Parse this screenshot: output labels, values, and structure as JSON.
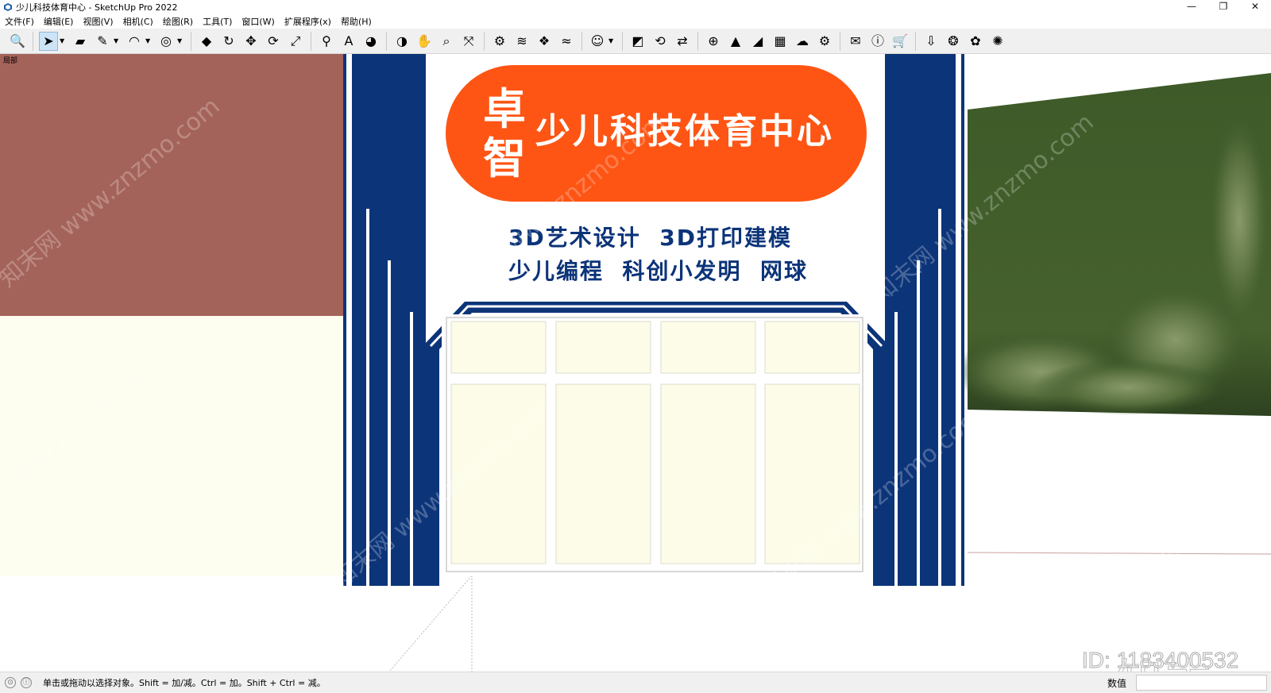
{
  "window": {
    "title": "少儿科技体育中心 - SketchUp Pro 2022",
    "controls": [
      "—",
      "❐",
      "✕"
    ]
  },
  "menu": [
    "文件(F)",
    "编辑(E)",
    "视图(V)",
    "相机(C)",
    "绘图(R)",
    "工具(T)",
    "窗口(W)",
    "扩展程序(x)",
    "帮助(H)"
  ],
  "toolbar": {
    "tools": [
      {
        "icon": "zoom-icon",
        "glyph": "🔍"
      },
      {
        "icon": "select-arrow-icon",
        "glyph": "➤",
        "selected": true
      },
      {
        "icon": "eraser-icon",
        "glyph": "▰"
      },
      {
        "icon": "pencil-icon",
        "glyph": "✎"
      },
      {
        "icon": "arc-icon",
        "glyph": "◠"
      },
      {
        "icon": "circle-icon",
        "glyph": "◎"
      },
      {
        "icon": "push-pull-icon",
        "glyph": "◆"
      },
      {
        "icon": "follow-me-icon",
        "glyph": "↻"
      },
      {
        "icon": "move-icon",
        "glyph": "✥"
      },
      {
        "icon": "rotate-icon",
        "glyph": "⟳"
      },
      {
        "icon": "scale-icon",
        "glyph": "⤢"
      },
      {
        "icon": "tape-measure-icon",
        "glyph": "⚲"
      },
      {
        "icon": "text-icon",
        "glyph": "A"
      },
      {
        "icon": "paint-bucket-icon",
        "glyph": "◕"
      },
      {
        "icon": "orbit-icon",
        "glyph": "◑"
      },
      {
        "icon": "pan-icon",
        "glyph": "✋"
      },
      {
        "icon": "zoom-window-icon",
        "glyph": "⌕"
      },
      {
        "icon": "zoom-extents-icon",
        "glyph": "⤧"
      },
      {
        "icon": "warehouse-icon",
        "glyph": "⚙"
      },
      {
        "icon": "layers-icon",
        "glyph": "≋"
      },
      {
        "icon": "components-icon",
        "glyph": "❖"
      },
      {
        "icon": "extension-icon",
        "glyph": "≈"
      },
      {
        "icon": "account-icon",
        "glyph": "☺"
      },
      {
        "icon": "export-icon",
        "glyph": "◩"
      },
      {
        "icon": "refresh-icon",
        "glyph": "⟲"
      },
      {
        "icon": "transfer-icon",
        "glyph": "⇄"
      },
      {
        "icon": "add-icon",
        "glyph": "⊕"
      },
      {
        "icon": "tree-icon",
        "glyph": "▲"
      },
      {
        "icon": "terrain-icon",
        "glyph": "◢"
      },
      {
        "icon": "checker-icon",
        "glyph": "▦"
      },
      {
        "icon": "cloud-upload-icon",
        "glyph": "☁"
      },
      {
        "icon": "settings-icon",
        "glyph": "⚙"
      },
      {
        "icon": "mail-icon",
        "glyph": "✉"
      },
      {
        "icon": "info-icon",
        "glyph": "ⓘ"
      },
      {
        "icon": "cart-icon",
        "glyph": "🛒"
      },
      {
        "icon": "import-icon",
        "glyph": "⇩"
      },
      {
        "icon": "plugin-a-icon",
        "glyph": "❂"
      },
      {
        "icon": "plugin-b-icon",
        "glyph": "✿"
      },
      {
        "icon": "plugin-c-icon",
        "glyph": "✺"
      }
    ]
  },
  "scene": {
    "label": "局部",
    "colors": {
      "wall_red": "#a4635a",
      "wall_cream": "#fefef0",
      "navy": "#0c3479",
      "orange": "#fe5514",
      "green": "#3f5a2c"
    },
    "sign": {
      "badge_char_1": "卓",
      "badge_char_2": "智",
      "title": "少儿科技体育中心",
      "line1": "3D艺术设计  3D打印建模",
      "line2": "少儿编程  科创小发明  网球"
    }
  },
  "watermark": {
    "text": "知末网 www.znzmo.com",
    "logo": "知末",
    "id_text": "ID: 1183400532"
  },
  "status": {
    "hint": "单击或拖动以选择对象。Shift = 加/减。Ctrl = 加。Shift + Ctrl = 减。",
    "vcb_label": "数值",
    "vcb_value": ""
  }
}
